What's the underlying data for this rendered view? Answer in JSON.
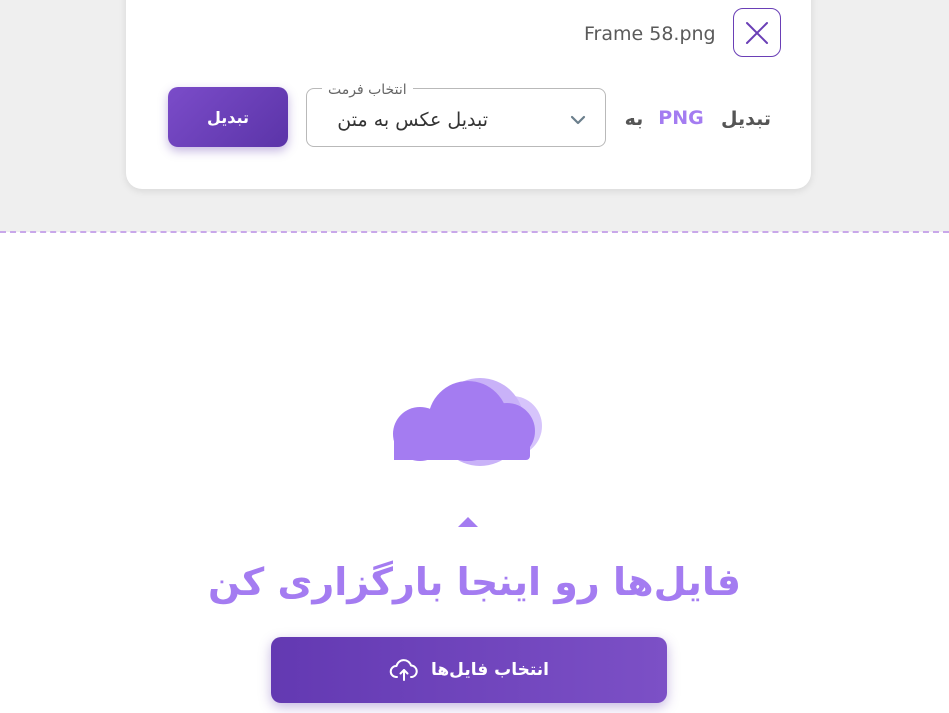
{
  "file_card": {
    "file_name": "Frame 58.png",
    "convert_label": "تبدیل",
    "source_format": "PNG",
    "to_label": "به",
    "format_select": {
      "legend": "انتخاب فرمت",
      "value": "تبدیل عکس به متن"
    },
    "convert_button": "تبدیل"
  },
  "upload": {
    "title": "فایل‌ها رو اینجا بارگزاری کن",
    "select_button": "انتخاب فایل‌ها"
  },
  "icons": {
    "close": "close-icon",
    "chevron": "chevron-down-icon",
    "cloud": "cloud-icon",
    "upload": "cloud-upload-icon"
  },
  "colors": {
    "accent": "#a47cf1",
    "primary": "#6339b2",
    "background_top": "#efefef"
  }
}
